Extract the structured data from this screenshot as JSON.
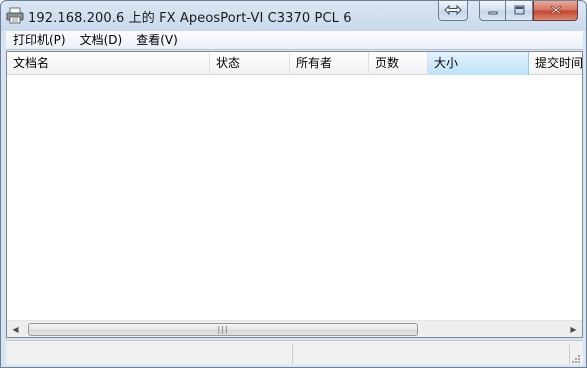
{
  "window": {
    "title": "192.168.200.6 上的 FX ApeosPort-VI C3370 PCL 6",
    "app_icon": "printer-icon"
  },
  "titlebar_buttons": {
    "restore_icon": "resize-arrows-icon",
    "minimize_icon": "minimize-icon",
    "maximize_icon": "maximize-icon",
    "close_icon": "close-icon"
  },
  "menu": [
    {
      "label": "打印机(P)"
    },
    {
      "label": "文档(D)"
    },
    {
      "label": "查看(V)"
    }
  ],
  "columns": [
    {
      "label": "文档名"
    },
    {
      "label": "状态"
    },
    {
      "label": "所有者"
    },
    {
      "label": "页数"
    },
    {
      "label": "大小",
      "active": true
    },
    {
      "label": "提交时间"
    }
  ],
  "rows": [],
  "scrollbar": {
    "left_arrow": "◀",
    "right_arrow": "▶",
    "grip": "|||"
  },
  "statusbar": {
    "pane_1": "",
    "pane_2": ""
  },
  "colors": {
    "header_active": "#bfe2f8",
    "close_button": "#c5432b",
    "frame": "#c9d9ec"
  }
}
